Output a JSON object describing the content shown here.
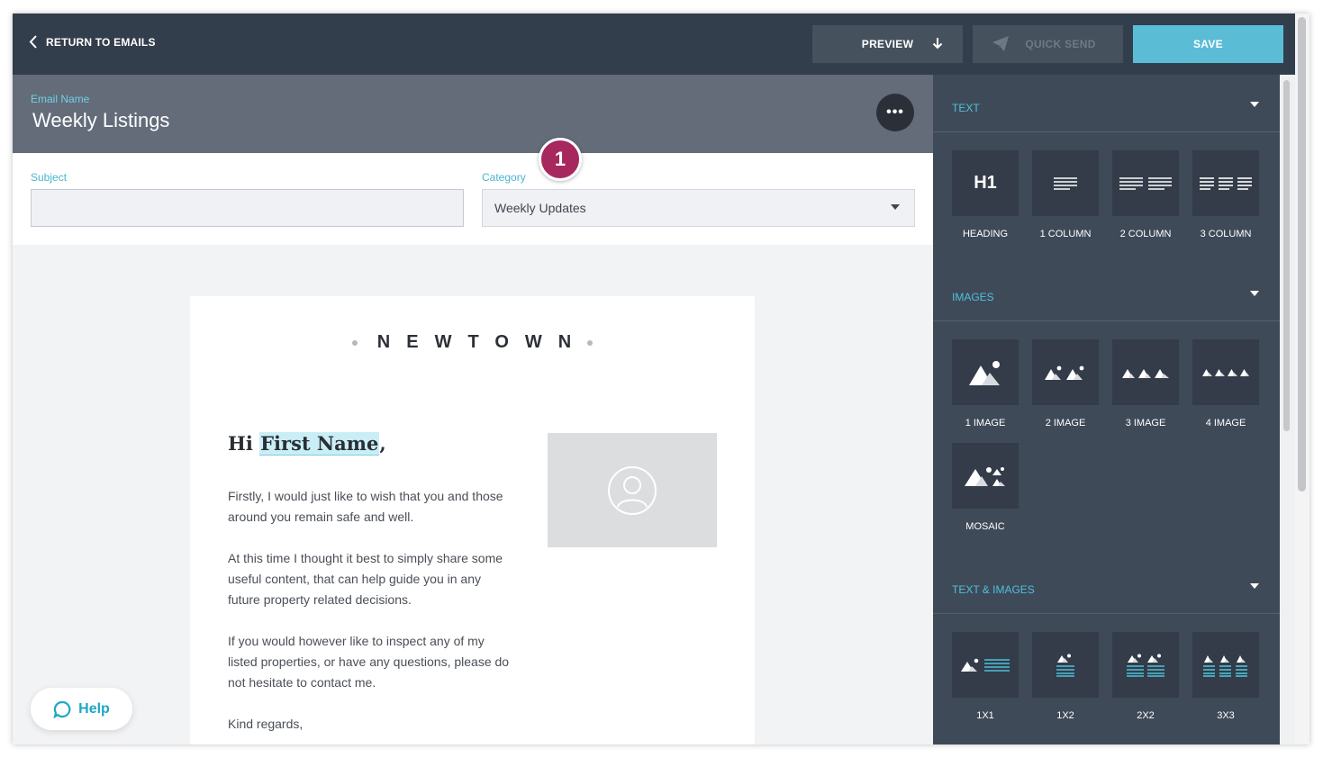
{
  "topbar": {
    "back_label": "RETURN TO EMAILS",
    "preview_label": "PREVIEW",
    "quick_send_label": "QUICK SEND",
    "save_label": "SAVE"
  },
  "email": {
    "name_label": "Email Name",
    "name_value": "Weekly Listings"
  },
  "fields": {
    "subject_label": "Subject",
    "subject_value": "",
    "category_label": "Category",
    "category_value": "Weekly Updates"
  },
  "step_badge": "1",
  "canvas": {
    "logo": "NEWTOWN",
    "greeting_prefix": "Hi ",
    "greeting_token": "First Name",
    "greeting_suffix": ",",
    "paragraphs": [
      "Firstly, I would just like to wish that you and those around you remain safe and well.",
      "At this time I thought it best to simply share some useful content, that can help guide you in any future property related decisions.",
      "If you would however like to inspect any of my listed properties, or have any questions, please do not hesitate to contact me.",
      "Kind regards,"
    ]
  },
  "help_label": "Help",
  "panel": {
    "text_section": "TEXT",
    "text_tiles": [
      "HEADING",
      "1 COLUMN",
      "2 COLUMN",
      "3 COLUMN"
    ],
    "heading_glyph": "H1",
    "images_section": "IMAGES",
    "image_tiles": [
      "1 IMAGE",
      "2 IMAGE",
      "3 IMAGE",
      "4 IMAGE",
      "MOSAIC"
    ],
    "text_images_section": "TEXT & IMAGES",
    "text_image_tiles": [
      "1X1",
      "1X2",
      "2X2",
      "3X3"
    ]
  },
  "colors": {
    "topbar": "#333e4c",
    "accent": "#5bbcd6",
    "badge": "#a6285f",
    "panel": "#3f4a58"
  }
}
